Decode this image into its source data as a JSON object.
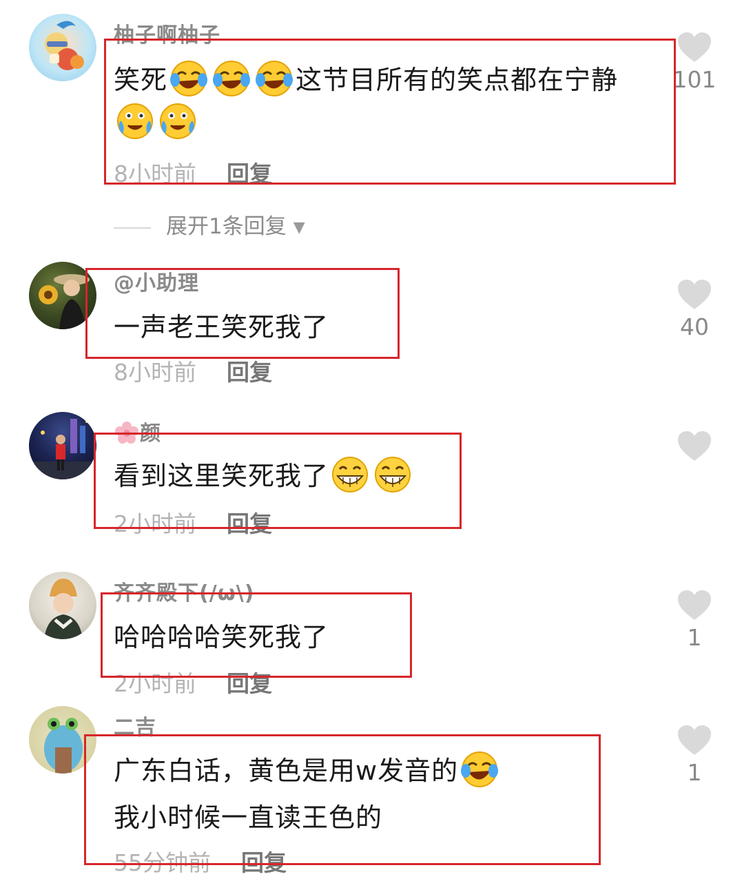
{
  "comments": [
    {
      "username": "柚子啊柚子",
      "line1": "笑死",
      "line1b": "这节目所有的笑点都在宁静",
      "time": "8小时前",
      "reply": "回复",
      "likes": "101",
      "avatar_icon": "avatar-cartoon-icon",
      "emojis": [
        "laugh-cry-emoji",
        "laugh-cry-emoji",
        "laugh-cry-emoji",
        "tears-of-joy-emoji",
        "tears-of-joy-emoji"
      ]
    },
    {
      "username": "@小助理",
      "line1": "一声老王笑死我了",
      "time": "8小时前",
      "reply": "回复",
      "likes": "40",
      "avatar_icon": "avatar-photo-icon"
    },
    {
      "username": "颜",
      "line1": "看到这里笑死我了",
      "time": "2小时前",
      "reply": "回复",
      "likes": "",
      "avatar_icon": "avatar-night-photo-icon",
      "emojis": [
        "grin-emoji",
        "grin-emoji"
      ]
    },
    {
      "username": "齐齐殿下(/ω\\)",
      "line1": "哈哈哈哈笑死我了",
      "time": "2小时前",
      "reply": "回复",
      "likes": "1",
      "avatar_icon": "avatar-portrait-icon"
    },
    {
      "username": "二吉",
      "line1": "广东白话，黄色是用w发音的",
      "line2": "我小时候一直读王色的",
      "time": "55分钟前",
      "reply": "回复",
      "likes": "1",
      "avatar_icon": "avatar-cartoon-green-icon",
      "emojis": [
        "laugh-cry-emoji"
      ]
    }
  ],
  "expand_replies": "展开1条回复",
  "colors": {
    "highlight_border": "#d6262a",
    "heart": "#d9d9d9",
    "meta_text": "#b4b4b4",
    "username_text": "#8a8a8a"
  }
}
